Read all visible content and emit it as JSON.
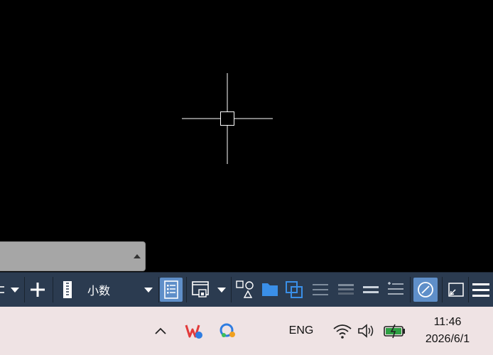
{
  "statusbar": {
    "units_label": "小数"
  },
  "taskbar": {
    "language": "ENG",
    "time": "11:46",
    "date": "2026/6/1"
  },
  "icons": {
    "crosshair": "crosshair-cursor",
    "grid": "grid-icon",
    "snap_mode": "plus-icon",
    "units": "ruler-icon",
    "properties": "quick-properties-icon",
    "workspace": "workspace-icon",
    "isolate": "shapes-icon",
    "folder": "folder-icon",
    "overlap": "overlap-icon",
    "lineweight": "lineweight-icon",
    "transparency": "transparency-icon",
    "hardware": "graphics-icon",
    "compass": "compass-icon",
    "fullscreen": "fullscreen-icon",
    "menu": "hamburger-icon"
  },
  "colors": {
    "statusbar_bg": "#2b3b50",
    "active_button": "#5f8fc9",
    "taskbar_bg": "#efe3e4"
  }
}
